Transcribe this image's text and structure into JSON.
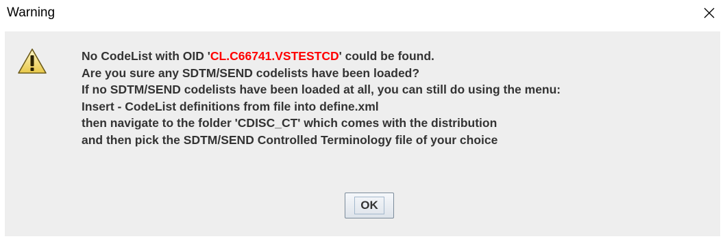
{
  "window": {
    "title": "Warning",
    "close_icon": "close-icon"
  },
  "dialog": {
    "icon": "warning-triangle-icon",
    "line1_prefix": "No CodeList with OID '",
    "line1_oid": "CL.C66741.VSTESTCD",
    "line1_suffix": "' could be found.",
    "lines": [
      "Are you sure any SDTM/SEND codelists have been loaded?",
      "If no SDTM/SEND codelists have been loaded at all, you can still do using the menu:",
      "Insert - CodeList definitions from file into define.xml",
      "then navigate to the folder 'CDISC_CT' which comes with the distribution",
      "and then pick the SDTM/SEND Controlled Terminology file of your choice"
    ],
    "ok_label": "OK"
  },
  "colors": {
    "oid_highlight": "#ff0000",
    "text": "#333333",
    "panel_background": "#eeeeee"
  }
}
